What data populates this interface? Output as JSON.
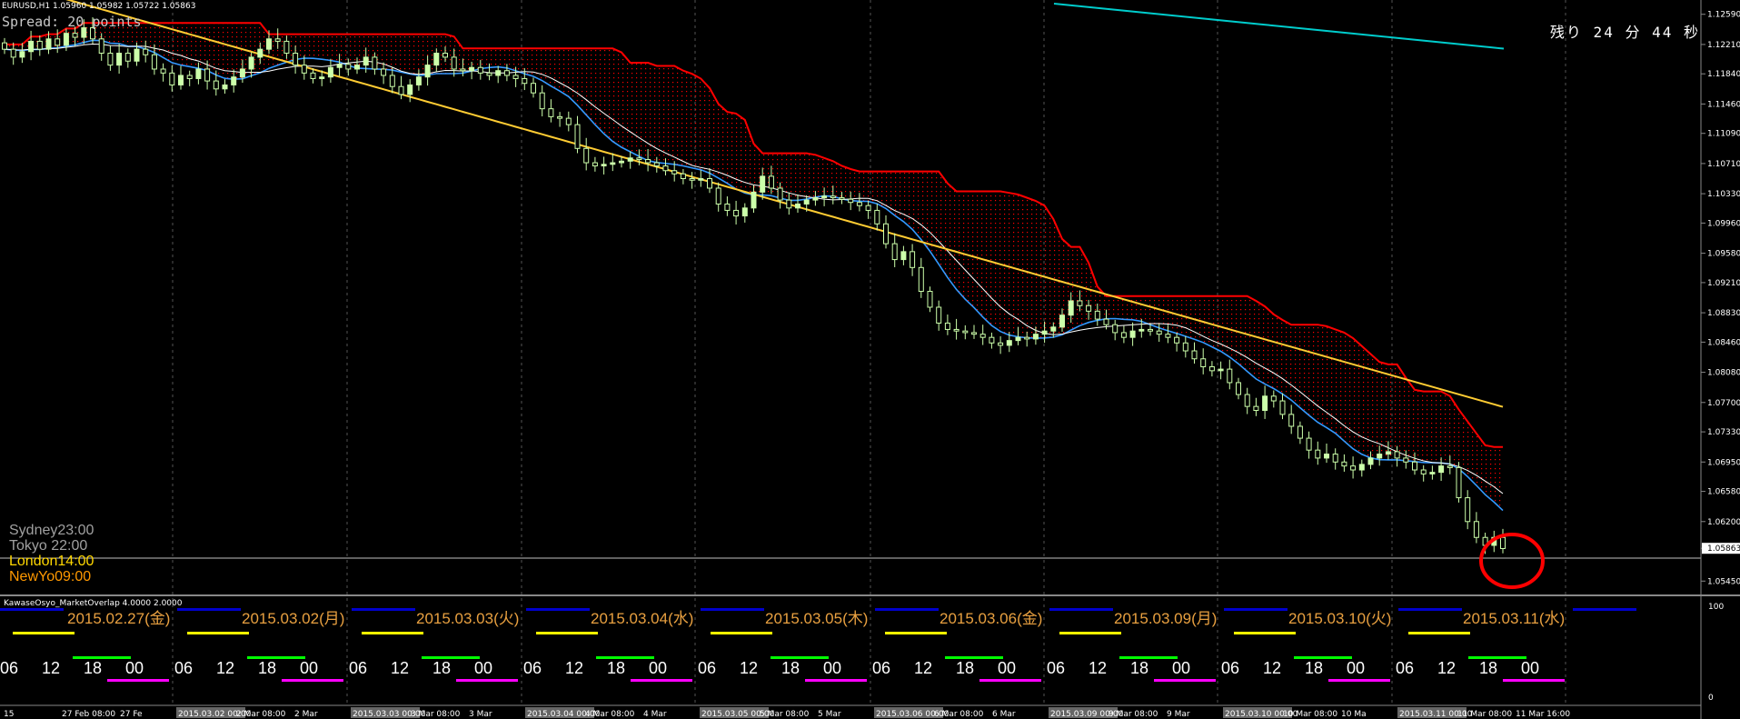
{
  "symbol_info": "EURUSD,H1  1.05960 1.05982 1.05722 1.05863",
  "spread_text": "Spread: 20 points",
  "remaining_text": "残り 24 分 44 秒",
  "sessions": [
    {
      "label": "Sydney23:00",
      "color": "#a0a0a0"
    },
    {
      "label": "Tokyo  22:00",
      "color": "#a0a0a0"
    },
    {
      "label": "London14:00",
      "color": "#ffd700"
    },
    {
      "label": "NewYo09:00",
      "color": "#ff9900"
    }
  ],
  "indicator_name": "KawaseOsyo_MarketOverlap 4.0000 2.0000",
  "colors": {
    "bull_candle": "#ccffaa",
    "bear_candle": "#ccffaa",
    "cloud": "#ff0000",
    "tenkan": "#3399ff",
    "ma_short": "#ffffff",
    "ma_long": "#ffcc33",
    "ma_longest": "#00cccc",
    "grid": "#555555",
    "highlight_circle": "#ff0000",
    "asia_bar": "#0000cc",
    "europe_bar": "#ffff00",
    "london_bar": "#00ff00",
    "ny_bar": "#ff00ff",
    "date_label": "#e8a040"
  },
  "chart_data": {
    "type": "candlestick",
    "title": "",
    "price_axis": {
      "ylim": [
        1.0527,
        1.1277
      ],
      "ticks": [
        "1.12590",
        "1.12210",
        "1.11840",
        "1.11460",
        "1.11090",
        "1.10710",
        "1.10330",
        "1.09960",
        "1.09580",
        "1.09210",
        "1.08830",
        "1.08460",
        "1.08080",
        "1.07700",
        "1.07330",
        "1.06950",
        "1.06580",
        "1.06200",
        "1.05863",
        "1.05450"
      ],
      "current_price": "1.05863"
    },
    "time_axis": {
      "labels": [
        "15",
        "27 Feb 08:00",
        "27 Fe",
        "2015.03.02 00:00",
        "2 Mar 08:00",
        "2 Mar",
        "2015.03.03 00:00",
        "3 Mar 08:00",
        "3 Mar",
        "2015.03.04 00:00",
        "4 Mar 08:00",
        "4 Mar",
        "2015.03.05 00:00",
        "5 Mar 08:00",
        "5 Mar",
        "2015.03.06 00:00",
        "6 Mar 08:00",
        "6 Mar",
        "2015.03.09 00:00",
        "9 Mar 08:00",
        "9 Mar",
        "2015.03.10 00:00",
        "10 Mar 08:00",
        "10 Ma",
        "2015.03.11 00:00",
        "11 Mar 08:00",
        "11 Mar 16:00"
      ]
    },
    "closes": [
      1.1215,
      1.1205,
      1.1212,
      1.1225,
      1.1215,
      1.1228,
      1.122,
      1.1235,
      1.123,
      1.1242,
      1.1228,
      1.121,
      1.1195,
      1.121,
      1.12,
      1.1215,
      1.1208,
      1.119,
      1.1185,
      1.117,
      1.1182,
      1.1178,
      1.119,
      1.1175,
      1.1165,
      1.117,
      1.118,
      1.119,
      1.1205,
      1.1215,
      1.1228,
      1.1225,
      1.121,
      1.1195,
      1.1185,
      1.1178,
      1.118,
      1.1192,
      1.1196,
      1.119,
      1.1195,
      1.1205,
      1.119,
      1.1182,
      1.1168,
      1.1158,
      1.117,
      1.118,
      1.1195,
      1.121,
      1.1205,
      1.119,
      1.1188,
      1.1192,
      1.1185,
      1.1182,
      1.1188,
      1.1182,
      1.1178,
      1.1172,
      1.116,
      1.114,
      1.113,
      1.1128,
      1.112,
      1.109,
      1.1072,
      1.1068,
      1.107,
      1.1072,
      1.1074,
      1.1078,
      1.1076,
      1.1072,
      1.1068,
      1.1062,
      1.1058,
      1.1052,
      1.105,
      1.1052,
      1.104,
      1.102,
      1.1012,
      1.1005,
      1.1015,
      1.1035,
      1.1055,
      1.104,
      1.1025,
      1.1015,
      1.102,
      1.1025,
      1.1028,
      1.103,
      1.1028,
      1.1026,
      1.1022,
      1.1018,
      1.1012,
      1.0995,
      1.097,
      1.095,
      1.096,
      1.094,
      1.091,
      1.089,
      1.087,
      1.0862,
      1.086,
      1.0858,
      1.0856,
      1.0852,
      1.0845,
      1.0842,
      1.0848,
      1.0852,
      1.085,
      1.0856,
      1.086,
      1.0865,
      1.088,
      1.0898,
      1.0892,
      1.0885,
      1.0875,
      1.0868,
      1.0858,
      1.0852,
      1.086,
      1.0862,
      1.086,
      1.0856,
      1.0852,
      1.0845,
      1.0835,
      1.0825,
      1.0815,
      1.081,
      1.0812,
      1.0795,
      1.078,
      1.0765,
      1.076,
      1.0778,
      1.0772,
      1.0755,
      1.074,
      1.0725,
      1.071,
      1.07,
      1.0705,
      1.0695,
      1.069,
      1.0685,
      1.0692,
      1.07,
      1.0705,
      1.0708,
      1.07,
      1.0695,
      1.0685,
      1.068,
      1.0682,
      1.069,
      1.0688,
      1.065,
      1.062,
      1.06,
      1.059,
      1.06,
      1.0586
    ]
  }
}
